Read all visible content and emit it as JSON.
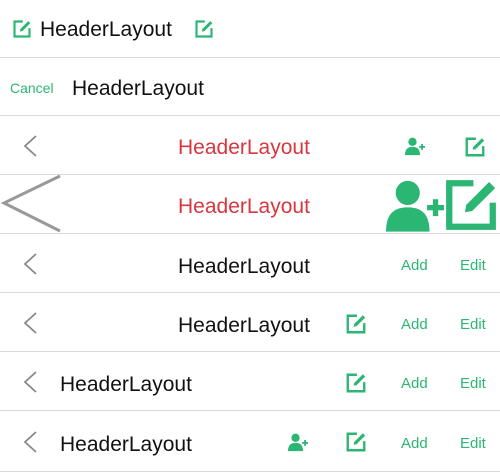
{
  "colors": {
    "accent": "#2bb673",
    "title_red": "#d9363e",
    "divider": "#d9d9d9"
  },
  "row1": {
    "title": "HeaderLayout",
    "left_icon": "edit-icon",
    "right_icon": "edit-icon"
  },
  "row2": {
    "cancel_label": "Cancel",
    "title": "HeaderLayout"
  },
  "row3": {
    "title": "HeaderLayout",
    "back_icon": "chevron-left-icon",
    "icons": [
      "add-user-icon",
      "edit-icon"
    ]
  },
  "row4": {
    "title": "HeaderLayout",
    "back_icon": "chevron-left-icon",
    "icons": [
      "add-user-icon",
      "edit-icon"
    ]
  },
  "row5": {
    "title": "HeaderLayout",
    "add_label": "Add",
    "edit_label": "Edit"
  },
  "row6": {
    "title": "HeaderLayout",
    "add_label": "Add",
    "edit_label": "Edit"
  },
  "row7": {
    "title": "HeaderLayout",
    "add_label": "Add",
    "edit_label": "Edit"
  },
  "row8": {
    "title": "HeaderLayout",
    "add_label": "Add",
    "edit_label": "Edit"
  }
}
